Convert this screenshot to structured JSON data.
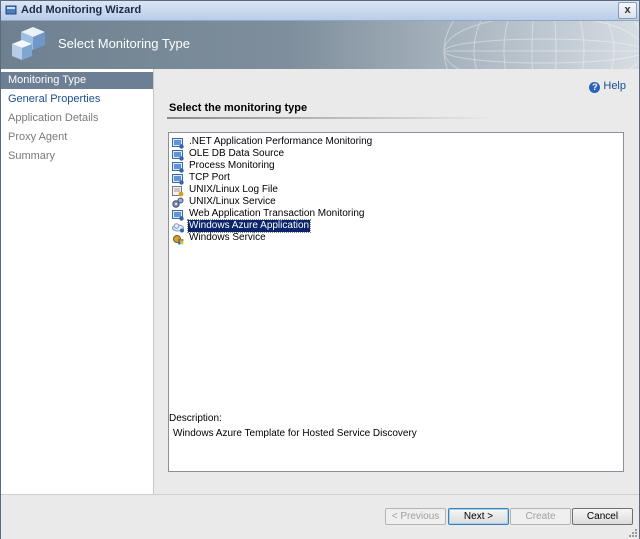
{
  "window": {
    "title": "Add Monitoring Wizard",
    "close_glyph": "x"
  },
  "header": {
    "title": "Select Monitoring Type",
    "icon": "wizard-cubes-icon"
  },
  "sidebar": {
    "items": [
      {
        "label": "Monitoring Type",
        "state": "selected"
      },
      {
        "label": "General Properties",
        "state": "link"
      },
      {
        "label": "Application Details",
        "state": "disabled"
      },
      {
        "label": "Proxy Agent",
        "state": "disabled"
      },
      {
        "label": "Summary",
        "state": "disabled"
      }
    ]
  },
  "main": {
    "help_label": "Help",
    "section_title": "Select the monitoring type",
    "monitoring_types": [
      {
        "label": ".NET Application Performance Monitoring",
        "icon": "monitor-icon"
      },
      {
        "label": "OLE DB Data Source",
        "icon": "monitor-icon"
      },
      {
        "label": "Process Monitoring",
        "icon": "monitor-icon"
      },
      {
        "label": "TCP Port",
        "icon": "monitor-icon"
      },
      {
        "label": "UNIX/Linux Log File",
        "icon": "log-file-icon"
      },
      {
        "label": "UNIX/Linux Service",
        "icon": "service-gears-icon"
      },
      {
        "label": "Web Application Transaction Monitoring",
        "icon": "monitor-icon"
      },
      {
        "label": "Windows Azure Application",
        "icon": "azure-cloud-icon",
        "selected": true
      },
      {
        "label": "Windows Service",
        "icon": "windows-service-icon"
      }
    ],
    "description_label": "Description:",
    "description_text": "Windows Azure Template for Hosted Service Discovery"
  },
  "footer": {
    "previous_label": "< Previous",
    "next_label": "Next >",
    "create_label": "Create",
    "cancel_label": "Cancel"
  },
  "colors": {
    "selected_nav": "#6d7f94",
    "selected_item": "#0a246a",
    "link": "#1d4f91"
  }
}
